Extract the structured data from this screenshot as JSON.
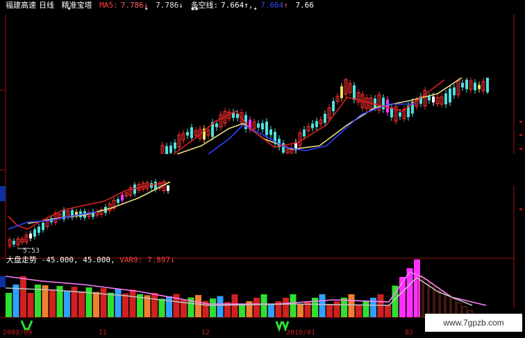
{
  "header": {
    "stock_name": "福建高速",
    "period": "日线",
    "indicator": "精准宝塔",
    "ma5_label": "MA5:",
    "ma5_value": "7.786↓",
    "ma_value2": "7.786↓",
    "duokong_label": "多空线:",
    "duokong_value": "7.664↑,",
    "blue_label": "7.664",
    "blue_arrow": "↑",
    "last_value": "7.66"
  },
  "markers": [
    "✦",
    "✦",
    "✱✱",
    "✦"
  ],
  "low_label": "5.53",
  "lower_panel": {
    "title": "大盘走势",
    "param1": "-45.000,",
    "param2": "45.000,",
    "var_label": "VAR9:",
    "var_value": "7.897↓"
  },
  "date_labels": [
    "2009/09",
    "11",
    "12",
    "2010/01",
    "02"
  ],
  "watermark": "www.7gpzb.com",
  "colors": {
    "bg": "#000000",
    "up_candle": "#ff3030",
    "down_candle": "#50e0e0",
    "ma_yellow": "#f0e080",
    "ma_blue": "#3040ff",
    "ma_red": "#e02020",
    "axis_red": "#a01010",
    "bar_red": "#d02020",
    "bar_green": "#30e030",
    "bar_orange": "#f08030",
    "bar_blue": "#30a0ff",
    "bar_magenta": "#ff30ff",
    "hist_dark": "#803020"
  }
}
